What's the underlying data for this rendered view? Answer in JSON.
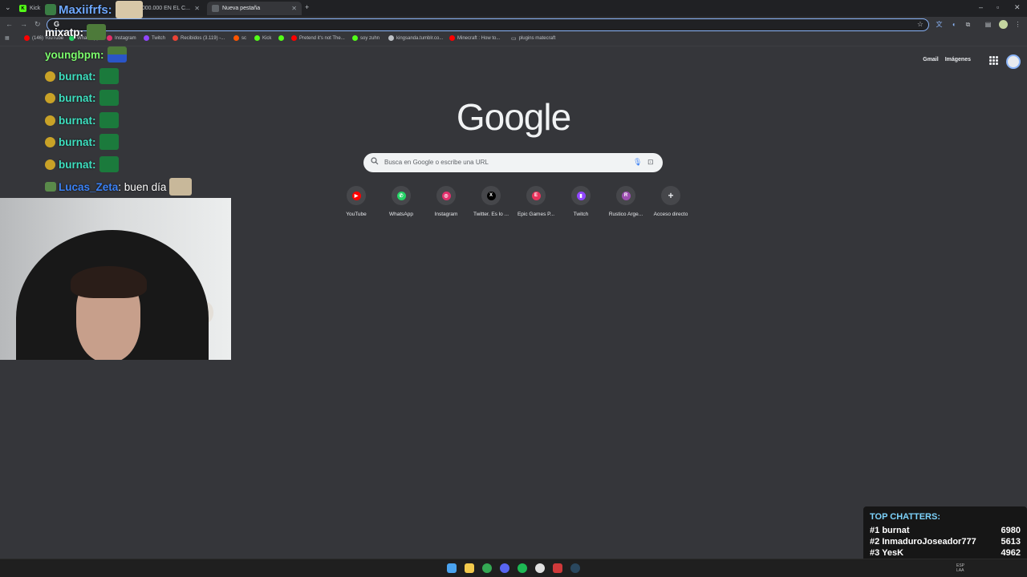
{
  "browser": {
    "tabs": [
      {
        "label": "Kick",
        "active": false
      },
      {
        "label": "2.000.000 EN EL C...",
        "active": false
      },
      {
        "label": "Nueva pestaña",
        "active": true
      }
    ],
    "omnibox_value": "G",
    "bookmarks": [
      {
        "label": "(146) YouTube",
        "color": "#ff0000"
      },
      {
        "label": "WhatsApp",
        "color": "#25d366"
      },
      {
        "label": "Instagram",
        "color": "#e1306c"
      },
      {
        "label": "Twitch",
        "color": "#9146ff"
      },
      {
        "label": "Recibidos (3.119) -...",
        "color": "#ea4335"
      },
      {
        "label": "sc",
        "color": "#ff5500"
      },
      {
        "label": "Kick",
        "color": "#53fc18"
      },
      {
        "label": "",
        "color": "#53fc18"
      },
      {
        "label": "Pretend it's not The...",
        "color": "#ff0000"
      },
      {
        "label": "soy zuhn",
        "color": "#53fc18"
      },
      {
        "label": "kingsanda.tumblr.co...",
        "color": "#bdc1c6"
      },
      {
        "label": "Minecraft : How to...",
        "color": "#ff0000"
      },
      {
        "label": "plugins matecraft",
        "color": "#bdc1c6"
      }
    ]
  },
  "ntp": {
    "links": {
      "gmail": "Gmail",
      "images": "Imágenes"
    },
    "logo": "Google",
    "search_placeholder": "Busca en Google o escribe una URL",
    "shortcuts": [
      {
        "label": "YouTube",
        "icon": "youtube-icon",
        "color": "#ff0000",
        "glyph": "▶"
      },
      {
        "label": "WhatsApp",
        "icon": "whatsapp-icon",
        "color": "#25d366",
        "glyph": "✆"
      },
      {
        "label": "Instagram",
        "icon": "instagram-icon",
        "color": "#e1306c",
        "glyph": "◎"
      },
      {
        "label": "Twitter. Es lo ...",
        "icon": "x-icon",
        "color": "#000000",
        "glyph": "X"
      },
      {
        "label": "Epic Games P...",
        "icon": "epic-icon",
        "color": "#e8335c",
        "glyph": "E"
      },
      {
        "label": "Twitch",
        "icon": "twitch-icon",
        "color": "#9146ff",
        "glyph": "▮"
      },
      {
        "label": "Rustico Arge...",
        "icon": "rustico-icon",
        "color": "#9c4fb0",
        "glyph": "R"
      },
      {
        "label": "Acceso directo",
        "icon": "plus-icon",
        "color": "#46474b",
        "glyph": "+"
      }
    ]
  },
  "chat": {
    "lines": [
      {
        "user": "Maxiifrfs:",
        "color": "#6ea8ff",
        "message": ""
      },
      {
        "user": "mixatp:",
        "color": "#ffffff",
        "message": ""
      },
      {
        "user": "youngbpm:",
        "color": "#7cfc6c",
        "message": ""
      },
      {
        "user": "burnat:",
        "color": "#3ee0c0",
        "message": ""
      },
      {
        "user": "burnat:",
        "color": "#3ee0c0",
        "message": ""
      },
      {
        "user": "burnat:",
        "color": "#3ee0c0",
        "message": ""
      },
      {
        "user": "burnat:",
        "color": "#3ee0c0",
        "message": ""
      },
      {
        "user": "burnat:",
        "color": "#3ee0c0",
        "message": ""
      },
      {
        "user": "Lucas_Zeta",
        "color": "#3b82f6",
        "message": ": buen día"
      }
    ]
  },
  "top_chatters": {
    "title": "TOP CHATTERS:",
    "rows": [
      {
        "rank": "#1",
        "name": "burnat",
        "count": "6980"
      },
      {
        "rank": "#2",
        "name": "InmaduroJoseador777",
        "count": "5613"
      },
      {
        "rank": "#3",
        "name": "YesK",
        "count": "4962"
      }
    ]
  },
  "taskbar": {
    "lang": "ESP",
    "lang2": "LAA"
  }
}
